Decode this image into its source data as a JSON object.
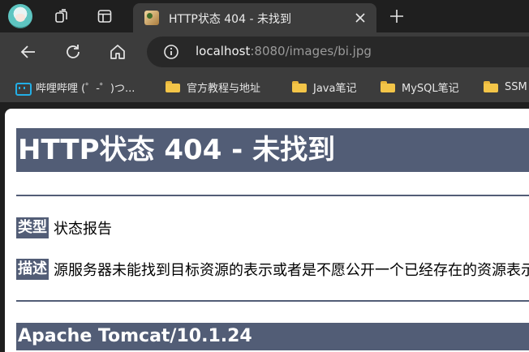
{
  "tab": {
    "title": "HTTP状态 404 - 未找到"
  },
  "address_bar": {
    "host": "localhost",
    "rest": ":8080/images/bi.jpg"
  },
  "bookmarks": [
    {
      "label": "哔哩哔哩 (゜-゜)つ...",
      "icon": "bilibili-icon"
    },
    {
      "label": "官方教程与地址",
      "icon": "folder-icon"
    },
    {
      "label": "Java笔记",
      "icon": "folder-icon"
    },
    {
      "label": "MySQL笔记",
      "icon": "folder-icon"
    },
    {
      "label": "SSM",
      "icon": "folder-icon"
    }
  ],
  "page": {
    "heading": "HTTP状态 404 - 未找到",
    "type_label": "类型",
    "type_value": "状态报告",
    "desc_label": "描述",
    "desc_value": "源服务器未能找到目标资源的表示或者是不愿公开一个已经存在的资源表示。",
    "footer": "Apache Tomcat/10.1.24"
  },
  "colors": {
    "heading_bg": "#525d76",
    "chrome_dark": "#1f1f1f",
    "chrome_toolbar": "#3c3c3c",
    "omnibox": "#282828"
  }
}
